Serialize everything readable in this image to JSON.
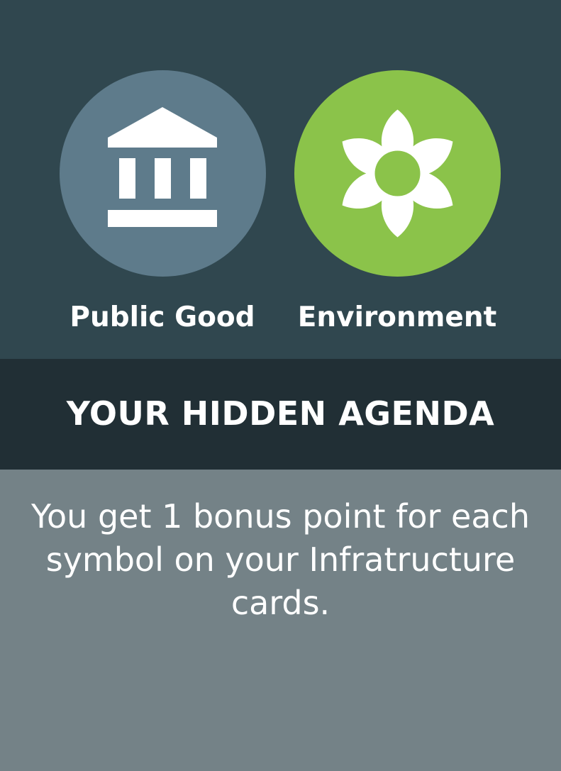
{
  "symbols": [
    {
      "label": "Public Good",
      "icon": "institution-icon",
      "color": "#5e7b8b"
    },
    {
      "label": "Environment",
      "icon": "flower-icon",
      "color": "#8bc34a"
    }
  ],
  "agenda": {
    "title": "YOUR HIDDEN AGENDA",
    "description": "You get 1 bonus point for each symbol on your Infratructure cards."
  },
  "colors": {
    "top_background": "#30474f",
    "title_band": "#212f35",
    "text_panel": "#748287",
    "text": "#ffffff"
  }
}
